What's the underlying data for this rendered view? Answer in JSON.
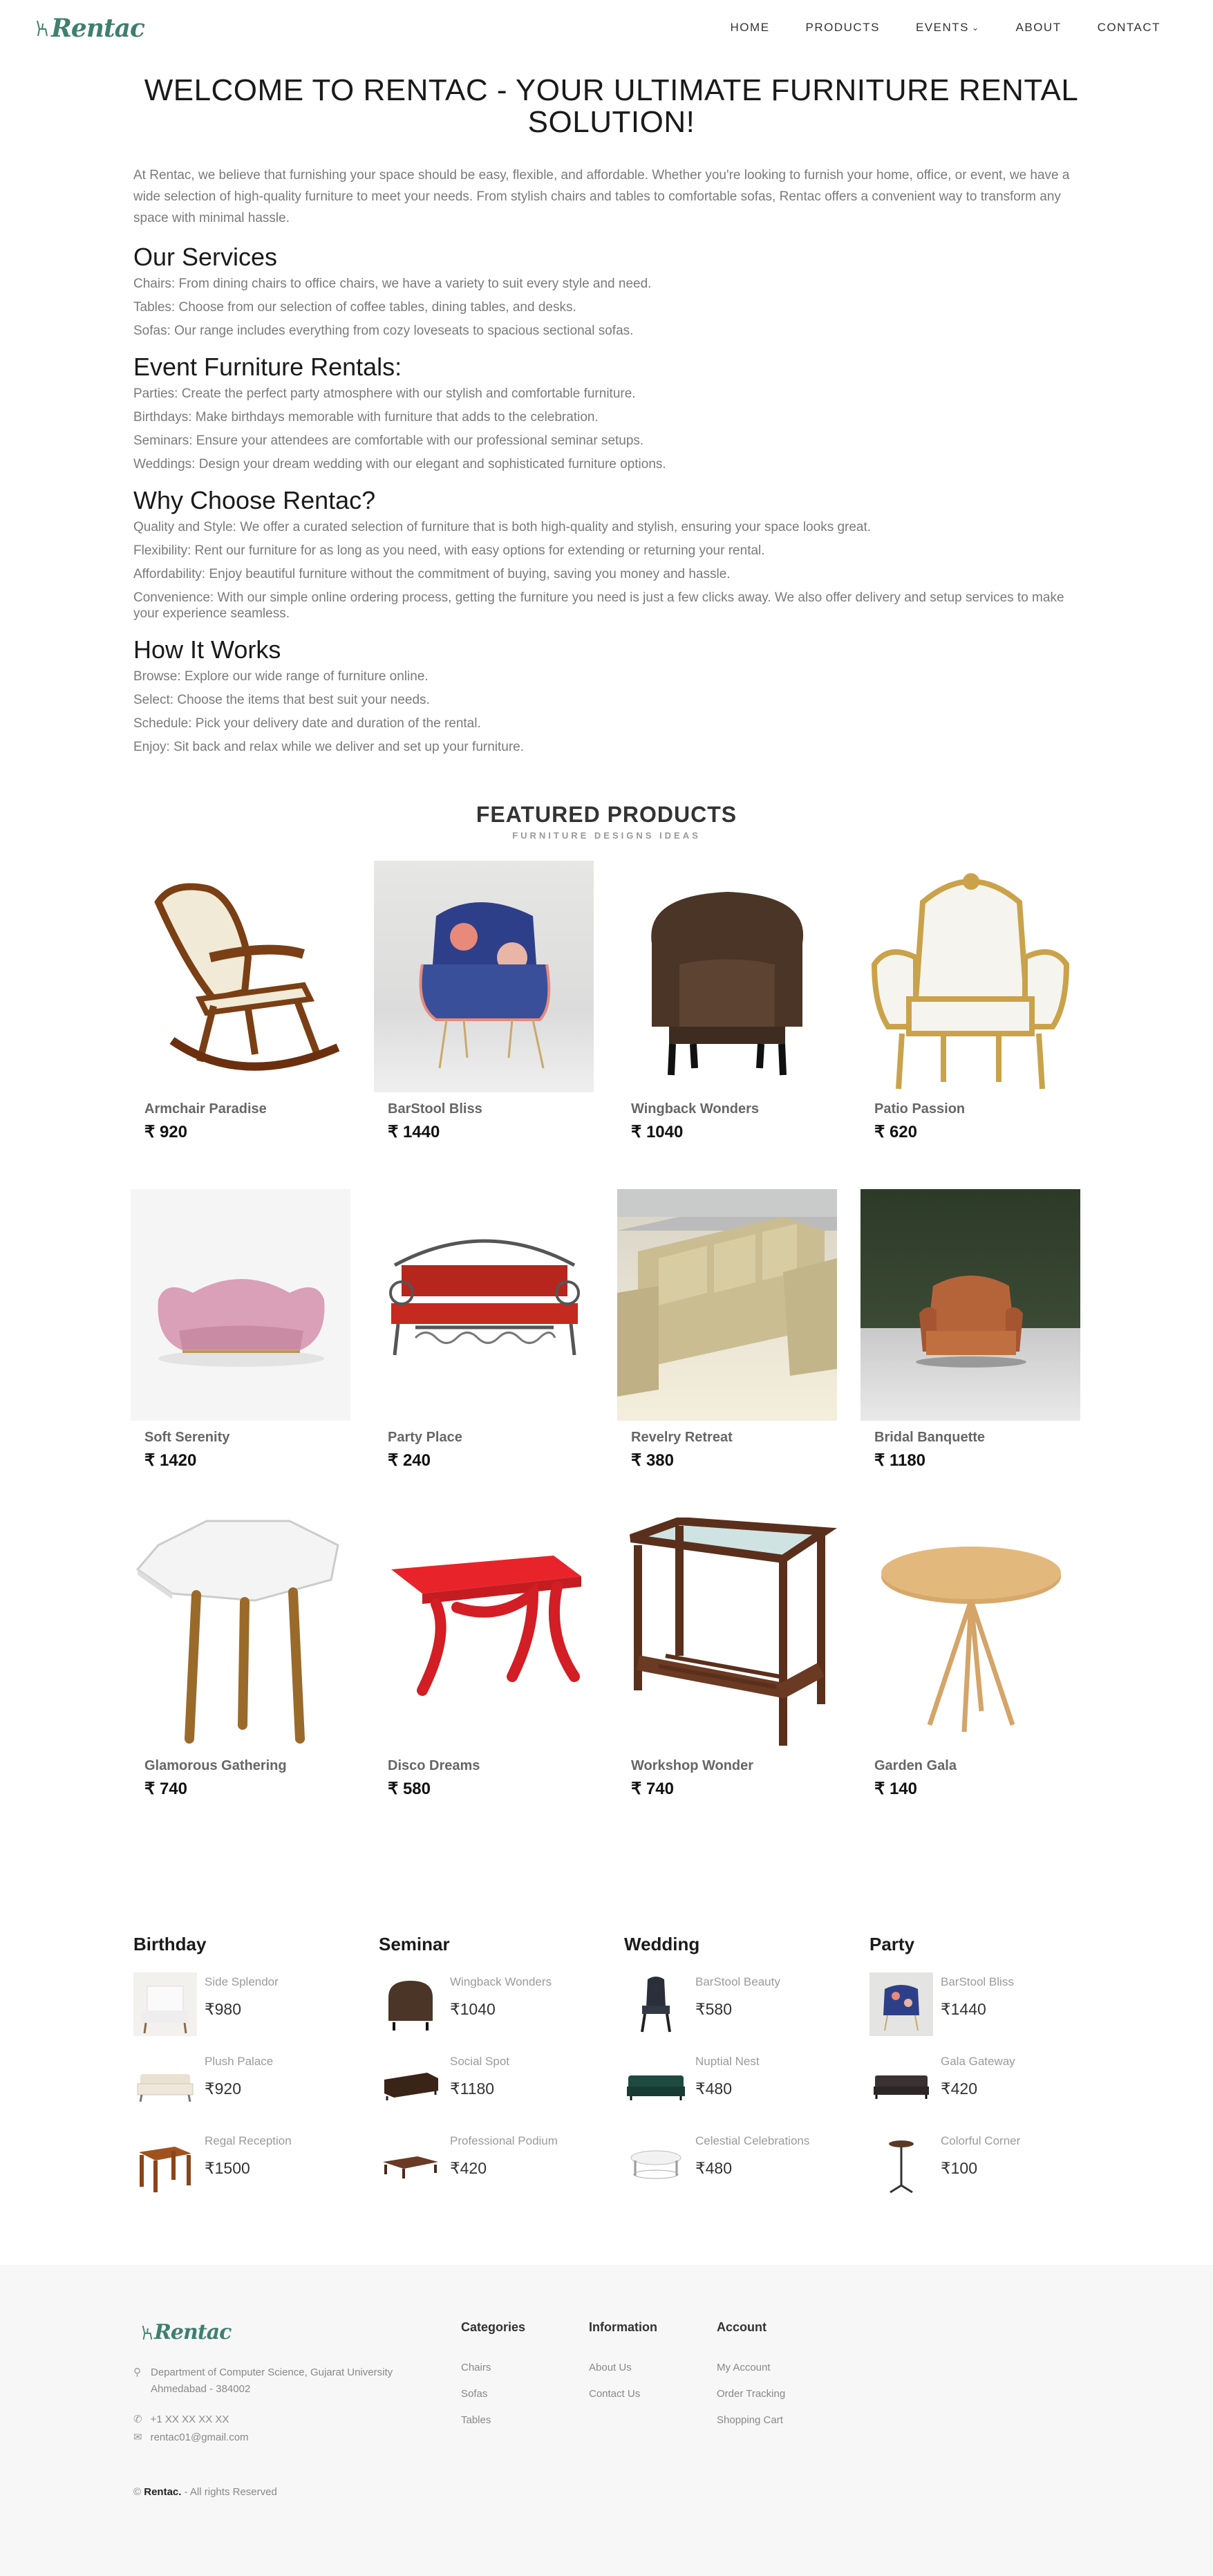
{
  "nav": {
    "logo": "Rentac",
    "items": [
      "HOME",
      "PRODUCTS",
      "EVENTS",
      "ABOUT",
      "CONTACT"
    ]
  },
  "intro": {
    "title_line1": "WELCOME TO RENTAC - YOUR ULTIMATE FURNITURE RENTAL",
    "title_line2": "SOLUTION!",
    "lead": "At Rentac, we believe that furnishing your space should be easy, flexible, and affordable. Whether you're looking to furnish your home, office, or event, we have a wide selection of high-quality furniture to meet your needs. From stylish chairs and tables to comfortable sofas, Rentac offers a convenient way to transform any space with minimal hassle.",
    "services": {
      "heading": "Our Services",
      "lines": [
        "Chairs: From dining chairs to office chairs, we have a variety to suit every style and need.",
        "Tables: Choose from our selection of coffee tables, dining tables, and desks.",
        "Sofas: Our range includes everything from cozy loveseats to spacious sectional sofas."
      ]
    },
    "events": {
      "heading": "Event Furniture Rentals:",
      "lines": [
        "Parties: Create the perfect party atmosphere with our stylish and comfortable furniture.",
        "Birthdays: Make birthdays memorable with furniture that adds to the celebration.",
        "Seminars: Ensure your attendees are comfortable with our professional seminar setups.",
        "Weddings: Design your dream wedding with our elegant and sophisticated furniture options."
      ]
    },
    "why": {
      "heading": "Why Choose Rentac?",
      "lines": [
        "Quality and Style: We offer a curated selection of furniture that is both high-quality and stylish, ensuring your space looks great.",
        "Flexibility: Rent our furniture for as long as you need, with easy options for extending or returning your rental.",
        "Affordability: Enjoy beautiful furniture without the commitment of buying, saving you money and hassle.",
        "Convenience: With our simple online ordering process, getting the furniture you need is just a few clicks away. We also offer delivery and setup services to make your experience seamless."
      ]
    },
    "how": {
      "heading": "How It Works",
      "lines": [
        "Browse: Explore our wide range of furniture online.",
        "Select: Choose the items that best suit your needs.",
        "Schedule: Pick your delivery date and duration of the rental.",
        "Enjoy: Sit back and relax while we deliver and set up your furniture."
      ]
    }
  },
  "featured": {
    "title": "FEATURED PRODUCTS",
    "subtitle": "FURNITURE DESIGNS IDEAS",
    "currency": "₹",
    "products": [
      {
        "name": "Armchair Paradise",
        "price": "920",
        "icon": "rocking-chair-icon"
      },
      {
        "name": "BarStool Bliss",
        "price": "1440",
        "icon": "floral-armchair-icon"
      },
      {
        "name": "Wingback Wonders",
        "price": "1040",
        "icon": "brown-tub-chair-icon"
      },
      {
        "name": "Patio Passion",
        "price": "620",
        "icon": "throne-chair-icon"
      },
      {
        "name": "Soft Serenity",
        "price": "1420",
        "icon": "pink-sofa-icon"
      },
      {
        "name": "Party Place",
        "price": "240",
        "icon": "red-bench-icon"
      },
      {
        "name": "Revelry Retreat",
        "price": "380",
        "icon": "beige-sofa-icon"
      },
      {
        "name": "Bridal Banquette",
        "price": "1180",
        "icon": "leather-armchair-icon"
      },
      {
        "name": "Glamorous Gathering",
        "price": "740",
        "icon": "white-side-table-icon"
      },
      {
        "name": "Disco Dreams",
        "price": "580",
        "icon": "red-table-icon"
      },
      {
        "name": "Workshop Wonder",
        "price": "740",
        "icon": "glass-top-table-icon"
      },
      {
        "name": "Garden Gala",
        "price": "140",
        "icon": "round-wood-table-icon"
      }
    ]
  },
  "categories": [
    {
      "title": "Birthday",
      "items": [
        {
          "name": "Side Splendor",
          "price": "980",
          "icon": "white-armchair-icon"
        },
        {
          "name": "Plush Palace",
          "price": "920",
          "icon": "cream-sofa-icon"
        },
        {
          "name": "Regal Reception",
          "price": "1500",
          "icon": "wood-table-icon"
        }
      ]
    },
    {
      "title": "Seminar",
      "items": [
        {
          "name": "Wingback Wonders",
          "price": "1040",
          "icon": "brown-tub-chair-icon"
        },
        {
          "name": "Social Spot",
          "price": "1180",
          "icon": "dark-sofa-icon"
        },
        {
          "name": "Professional Podium",
          "price": "420",
          "icon": "coffee-table-icon"
        }
      ]
    },
    {
      "title": "Wedding",
      "items": [
        {
          "name": "BarStool Beauty",
          "price": "580",
          "icon": "black-chair-icon"
        },
        {
          "name": "Nuptial Nest",
          "price": "480",
          "icon": "green-sofa-icon"
        },
        {
          "name": "Celestial Celebrations",
          "price": "480",
          "icon": "white-table-icon"
        }
      ]
    },
    {
      "title": "Party",
      "items": [
        {
          "name": "BarStool Bliss",
          "price": "1440",
          "icon": "floral-armchair-icon"
        },
        {
          "name": "Gala Gateway",
          "price": "420",
          "icon": "grey-sofa-icon"
        },
        {
          "name": "Colorful Corner",
          "price": "100",
          "icon": "bar-stool-icon"
        }
      ]
    }
  ],
  "footer": {
    "logo": "Rentac",
    "address_line1": "Department of Computer Science, Gujarat University",
    "address_line2": "Ahmedabad - 384002",
    "phone": "+1 XX XX XX XX",
    "email": "rentac01@gmail.com",
    "categories_title": "Categories",
    "categories": [
      "Chairs",
      "Sofas",
      "Tables"
    ],
    "information_title": "Information",
    "information": [
      "About Us",
      "Contact Us"
    ],
    "account_title": "Account",
    "account": [
      "My Account",
      "Order Tracking",
      "Shopping Cart"
    ],
    "copyright_symbol": "©",
    "copyright_brand": "Rentac.",
    "copyright_text": "- All rights Reserved"
  }
}
